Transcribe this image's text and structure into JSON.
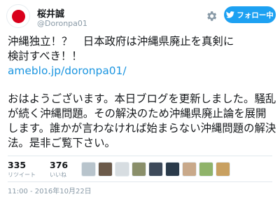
{
  "user": {
    "name": "桜井誠",
    "handle": "@Doronpa01"
  },
  "follow_button": {
    "label": "フォロー中"
  },
  "tweet": {
    "line1": "沖縄独立！？　日本政府は沖縄県廃止を真剣に\n検討すべき！！",
    "link": "ameblo.jp/doronpa01/",
    "para2": "おはようございます。本日ブログを更新しました。騒乱が続く沖縄問題。その解決のため沖縄県廃止論を展開します。誰かが言わなければ始まらない沖縄問題の解決法。是非ご覧下さい。"
  },
  "stats": {
    "retweets": {
      "count": "335",
      "label": "リツイート"
    },
    "likes": {
      "count": "376",
      "label": "いいね"
    }
  },
  "likers": [
    {
      "icon": "liker-avatar",
      "color": "#b8c4cc"
    },
    {
      "icon": "liker-avatar",
      "color": "#6b5a4a"
    },
    {
      "icon": "liker-avatar",
      "color": "#d7dde1"
    },
    {
      "icon": "liker-avatar",
      "color": "#8a8f6a"
    },
    {
      "icon": "liker-avatar",
      "color": "#3d4a5a"
    },
    {
      "icon": "liker-avatar",
      "color": "#2a3a4a"
    },
    {
      "icon": "liker-avatar",
      "color": "#c9a98a"
    },
    {
      "icon": "liker-avatar",
      "color": "#8fb36a"
    },
    {
      "icon": "liker-avatar",
      "color": "#c8a060"
    }
  ],
  "timestamp": "11:00 - 2016年10月22日",
  "colors": {
    "accent": "#1da1f2",
    "link": "#1b95e0",
    "flag_red": "#d9001b"
  }
}
